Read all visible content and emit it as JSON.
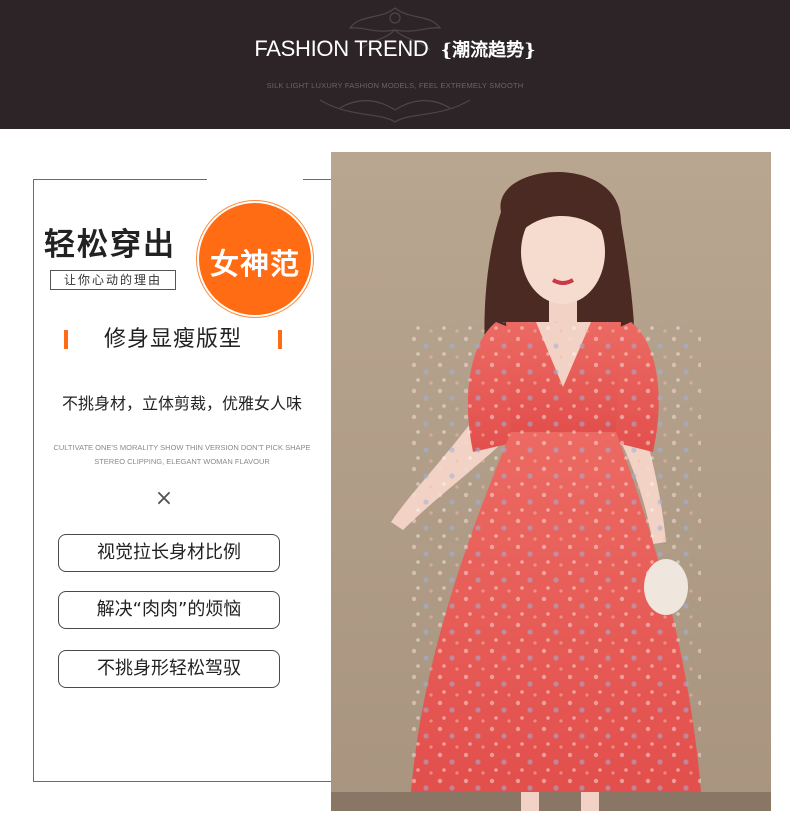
{
  "header": {
    "title_en": "FASHION TREND",
    "title_cn": "{潮流趋势}",
    "subtitle": "SILK LIGHT LUXURY FASHION MODELS, FEEL EXTREMELY SMOOTH"
  },
  "promo": {
    "headline": "轻松穿出",
    "reason": "让你心动的理由",
    "badge": "女神范",
    "subhead": "修身显瘦版型",
    "description": "不挑身材，立体剪裁，优雅女人味",
    "description_en_line1": "CULTIVATE ONE'S MORALITY SHOW THIN VERSION DON'T PICK SHAPE",
    "description_en_line2": "STEREO CLIPPING, ELEGANT WOMAN FLAVOUR",
    "separator": "×",
    "features": [
      "视觉拉长身材比例",
      "解决“肉肉”的烦恼",
      "不挑身形轻松驾驭"
    ]
  },
  "colors": {
    "header_bg": "#2c2426",
    "accent": "#ff6c14",
    "dress": "#e95a55"
  },
  "icons": {
    "separator": "close-icon"
  }
}
